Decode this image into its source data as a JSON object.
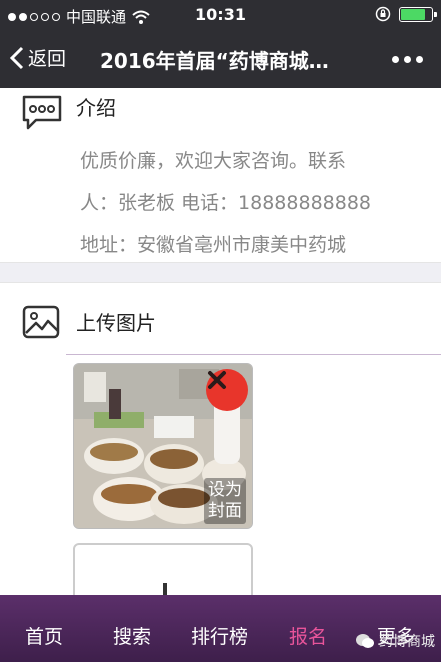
{
  "status_bar": {
    "carrier": "中国联通",
    "time": "10:31"
  },
  "nav": {
    "back_label": "返回",
    "title": "2016年首届“药博商城…"
  },
  "intro": {
    "title": "介绍",
    "lines": [
      "优质价廉，欢迎大家咨询。联系",
      "人：张老板 电话：18888888888",
      "地址：安徽省亳州市康美中药城"
    ]
  },
  "upload": {
    "title": "上传图片",
    "set_cover_label_1": "设为",
    "set_cover_label_2": "封面"
  },
  "tabbar": {
    "tabs": [
      "首页",
      "搜索",
      "排行榜",
      "报名",
      "更多"
    ],
    "active": "报名",
    "watermark": "药博商城"
  },
  "colors": {
    "tabbar": "#4a2658",
    "active_tab": "#e8549a",
    "delete": "#e8352b"
  }
}
